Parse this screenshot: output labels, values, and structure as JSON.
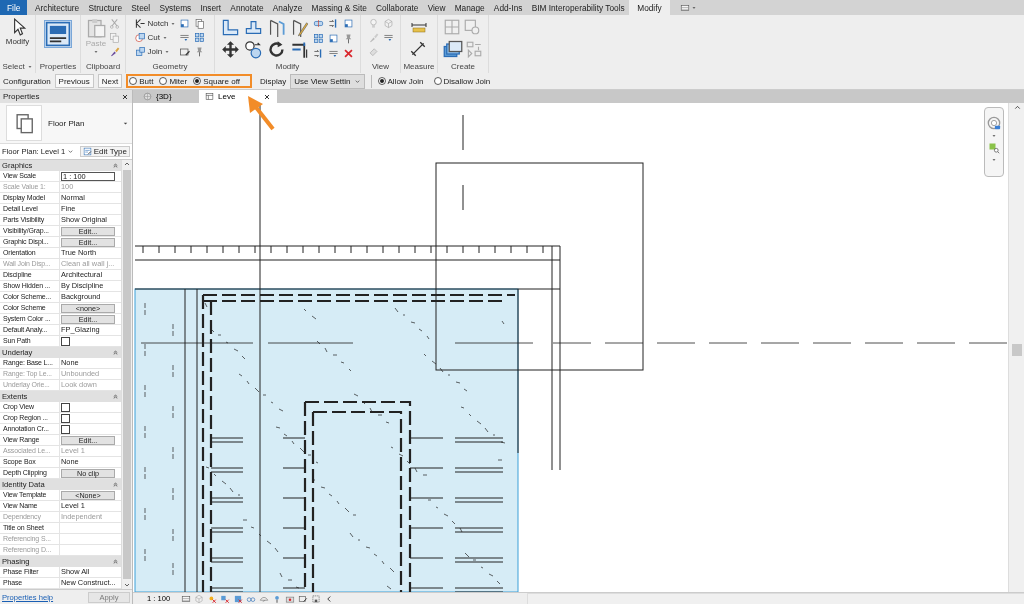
{
  "ribbon_tabs": [
    {
      "label": "File",
      "kind": "file",
      "selected": false
    },
    {
      "label": "Architecture",
      "kind": "tab",
      "selected": false
    },
    {
      "label": "Structure",
      "kind": "tab",
      "selected": false
    },
    {
      "label": "Steel",
      "kind": "tab",
      "selected": false
    },
    {
      "label": "Systems",
      "kind": "tab",
      "selected": false
    },
    {
      "label": "Insert",
      "kind": "tab",
      "selected": false
    },
    {
      "label": "Annotate",
      "kind": "tab",
      "selected": false
    },
    {
      "label": "Analyze",
      "kind": "tab",
      "selected": false
    },
    {
      "label": "Massing & Site",
      "kind": "tab",
      "selected": false
    },
    {
      "label": "Collaborate",
      "kind": "tab",
      "selected": false
    },
    {
      "label": "View",
      "kind": "tab",
      "selected": false
    },
    {
      "label": "Manage",
      "kind": "tab",
      "selected": false
    },
    {
      "label": "Add-Ins",
      "kind": "tab",
      "selected": false
    },
    {
      "label": "BIM Interoperability Tools",
      "kind": "tab",
      "selected": false
    },
    {
      "label": "Modify",
      "kind": "tab",
      "selected": true
    }
  ],
  "ribbon_panels": [
    {
      "title": "Select",
      "kind": "select",
      "tools": [
        {
          "label": "Modify",
          "disabled": false
        }
      ]
    },
    {
      "title": "Properties",
      "kind": "properties"
    },
    {
      "title": "Clipboard",
      "kind": "clipboard",
      "tools": [
        {
          "label": "Paste",
          "disabled": true
        }
      ]
    },
    {
      "title": "Geometry",
      "kind": "geometry",
      "tools": [
        {
          "label": "Notch",
          "disabled": false
        },
        {
          "label": "Cut",
          "disabled": false
        },
        {
          "label": "Join",
          "disabled": false
        }
      ]
    },
    {
      "title": "Modify",
      "kind": "modify"
    },
    {
      "title": "View",
      "kind": "view"
    },
    {
      "title": "Measure",
      "kind": "measure"
    },
    {
      "title": "Create",
      "kind": "create"
    }
  ],
  "options_bar": {
    "label": "Configuration",
    "buttons": [
      "Previous",
      "Next"
    ],
    "end_styles": [
      {
        "label": "Butt",
        "selected": false
      },
      {
        "label": "Miter",
        "selected": false
      },
      {
        "label": "Square off",
        "selected": true
      }
    ],
    "display_label": "Display",
    "display_value": "Use View Settin",
    "join_options": [
      {
        "label": "Allow Join",
        "selected": true
      },
      {
        "label": "Disallow Join",
        "selected": false
      }
    ]
  },
  "properties": {
    "title": "Properties",
    "type_name": "Floor Plan",
    "instance": "Floor Plan: Level 1",
    "edit_type": "Edit Type",
    "sections": [
      {
        "title": "Graphics",
        "rows": [
          {
            "name": "View Scale",
            "value": "1 : 100",
            "kind": "field",
            "disabled": false
          },
          {
            "name": "Scale Value    1:",
            "value": "100",
            "kind": "text",
            "disabled": true
          },
          {
            "name": "Display Model",
            "value": "Normal",
            "kind": "text",
            "disabled": false
          },
          {
            "name": "Detail Level",
            "value": "Fine",
            "kind": "text",
            "disabled": false
          },
          {
            "name": "Parts Visibility",
            "value": "Show Original",
            "kind": "text",
            "disabled": false
          },
          {
            "name": "Visibility/Grap...",
            "value": "Edit...",
            "kind": "button",
            "disabled": false
          },
          {
            "name": "Graphic Displ...",
            "value": "Edit...",
            "kind": "button",
            "disabled": false
          },
          {
            "name": "Orientation",
            "value": "True North",
            "kind": "text",
            "disabled": false
          },
          {
            "name": "Wall Join Disp...",
            "value": "Clean all wall j...",
            "kind": "text",
            "disabled": true
          },
          {
            "name": "Discipline",
            "value": "Architectural",
            "kind": "text",
            "disabled": false
          },
          {
            "name": "Show Hidden ...",
            "value": "By Discipline",
            "kind": "text",
            "disabled": false
          },
          {
            "name": "Color Scheme...",
            "value": "Background",
            "kind": "text",
            "disabled": false
          },
          {
            "name": "Color Scheme",
            "value": "<none>",
            "kind": "button",
            "disabled": false
          },
          {
            "name": "System Color ...",
            "value": "Edit...",
            "kind": "button",
            "disabled": false
          },
          {
            "name": "Default Analy...",
            "value": "FP_Glazing",
            "kind": "text",
            "disabled": false
          },
          {
            "name": "Sun Path",
            "kind": "checkbox",
            "checked": false,
            "disabled": false
          }
        ]
      },
      {
        "title": "Underlay",
        "rows": [
          {
            "name": "Range: Base L...",
            "value": "None",
            "kind": "text",
            "disabled": false
          },
          {
            "name": "Range: Top Le...",
            "value": "Unbounded",
            "kind": "text",
            "disabled": true
          },
          {
            "name": "Underlay Orie...",
            "value": "Look down",
            "kind": "text",
            "disabled": true
          }
        ]
      },
      {
        "title": "Extents",
        "rows": [
          {
            "name": "Crop View",
            "kind": "checkbox",
            "checked": false,
            "disabled": false
          },
          {
            "name": "Crop Region ...",
            "kind": "checkbox",
            "checked": false,
            "disabled": false
          },
          {
            "name": "Annotation Cr...",
            "kind": "checkbox",
            "checked": false,
            "disabled": false
          },
          {
            "name": "View Range",
            "value": "Edit...",
            "kind": "button",
            "disabled": false
          },
          {
            "name": "Associated Le...",
            "value": "Level 1",
            "kind": "text",
            "disabled": true
          },
          {
            "name": "Scope Box",
            "value": "None",
            "kind": "text",
            "disabled": false
          },
          {
            "name": "Depth Clipping",
            "value": "No clip",
            "kind": "button",
            "disabled": false
          }
        ]
      },
      {
        "title": "Identity Data",
        "rows": [
          {
            "name": "View Template",
            "value": "<None>",
            "kind": "button",
            "disabled": false
          },
          {
            "name": "View Name",
            "value": "Level 1",
            "kind": "text",
            "disabled": false
          },
          {
            "name": "Dependency",
            "value": "Independent",
            "kind": "text",
            "disabled": true
          },
          {
            "name": "Title on Sheet",
            "kind": "text",
            "disabled": false
          },
          {
            "name": "Referencing S...",
            "kind": "text",
            "disabled": true
          },
          {
            "name": "Referencing D...",
            "kind": "text",
            "disabled": true
          }
        ]
      },
      {
        "title": "Phasing",
        "rows": [
          {
            "name": "Phase Filter",
            "value": "Show All",
            "kind": "text",
            "disabled": false
          },
          {
            "name": "Phase",
            "value": "New Construct...",
            "kind": "text",
            "disabled": false
          }
        ]
      }
    ],
    "help_link": "Properties help",
    "apply": {
      "label": "Apply",
      "disabled": true
    }
  },
  "view_tabs": [
    {
      "label": "{3D}",
      "selected": false,
      "closable": false
    },
    {
      "label": "Leve",
      "selected": true,
      "closable": true
    }
  ],
  "status_bar": {
    "scale": "1 : 100"
  }
}
